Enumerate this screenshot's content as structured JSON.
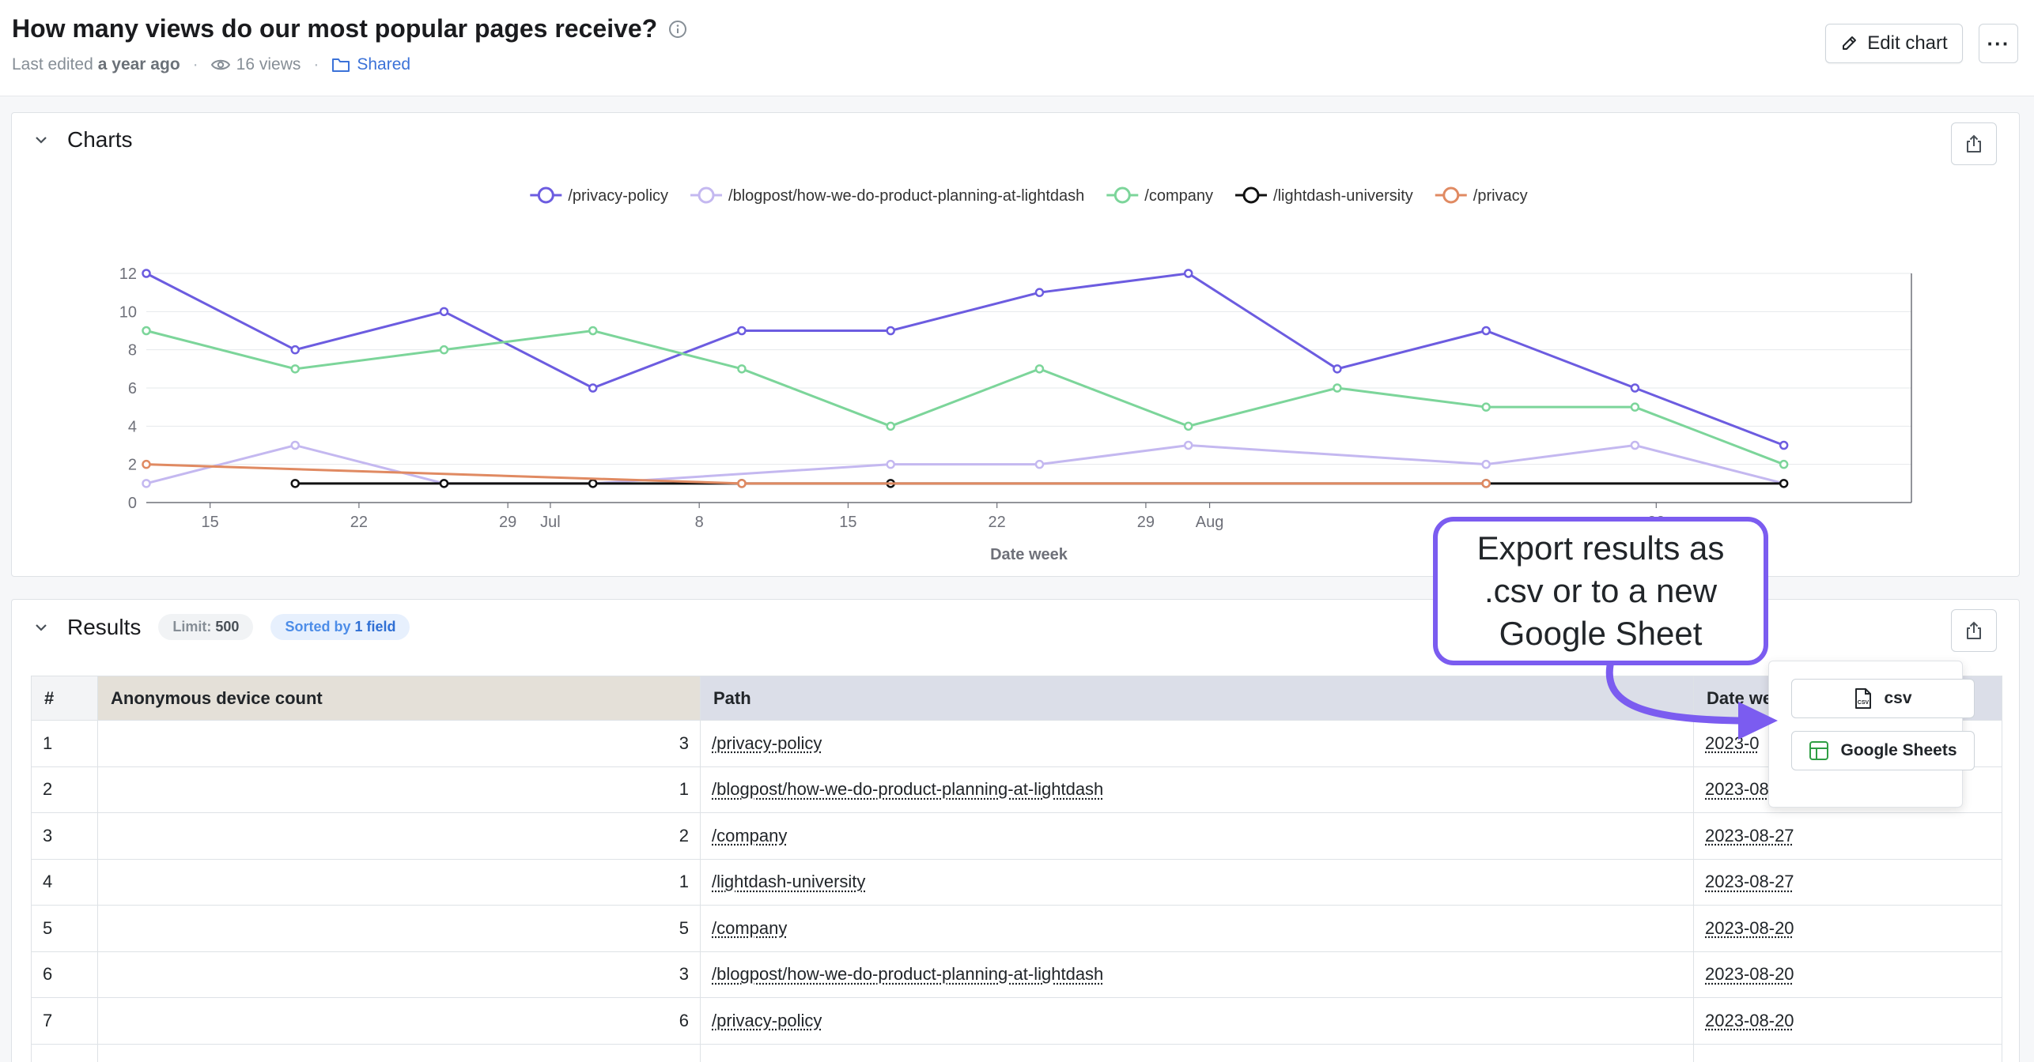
{
  "header": {
    "title": "How many views do our most popular pages receive?",
    "last_edited_prefix": "Last edited",
    "last_edited_value": "a year ago",
    "views": "16 views",
    "space": "Shared",
    "edit_label": "Edit chart",
    "more_label": "···"
  },
  "charts_panel": {
    "title": "Charts"
  },
  "chart_data": {
    "type": "line",
    "title": "",
    "xlabel": "Date week",
    "ylabel": "",
    "ylim": [
      0,
      12
    ],
    "yticks": [
      0,
      2,
      4,
      6,
      8,
      10,
      12
    ],
    "x_start": "2023-06-12",
    "x_end": "2023-09-03",
    "xticks": [
      {
        "date": "2023-06-15",
        "label": "15"
      },
      {
        "date": "2023-06-22",
        "label": "22"
      },
      {
        "date": "2023-06-29",
        "label": "29"
      },
      {
        "date": "2023-07-01",
        "label": "Jul"
      },
      {
        "date": "2023-07-08",
        "label": "8"
      },
      {
        "date": "2023-07-15",
        "label": "15"
      },
      {
        "date": "2023-07-22",
        "label": "22"
      },
      {
        "date": "2023-07-29",
        "label": "29"
      },
      {
        "date": "2023-08-01",
        "label": "Aug"
      },
      {
        "date": "2023-08-22",
        "label": "22"
      }
    ],
    "legend_position": "top-center",
    "grid": true,
    "series": [
      {
        "name": "/privacy-policy",
        "color": "#6c5ce0",
        "points": [
          [
            "2023-06-12",
            12
          ],
          [
            "2023-06-19",
            8
          ],
          [
            "2023-06-26",
            10
          ],
          [
            "2023-07-03",
            6
          ],
          [
            "2023-07-10",
            9
          ],
          [
            "2023-07-17",
            9
          ],
          [
            "2023-07-24",
            11
          ],
          [
            "2023-07-31",
            12
          ],
          [
            "2023-08-07",
            7
          ],
          [
            "2023-08-14",
            9
          ],
          [
            "2023-08-21",
            6
          ],
          [
            "2023-08-28",
            3
          ]
        ]
      },
      {
        "name": "/blogpost/how-we-do-product-planning-at-lightdash",
        "color": "#c4b8f0",
        "points": [
          [
            "2023-06-12",
            1
          ],
          [
            "2023-06-19",
            3
          ],
          [
            "2023-06-26",
            1
          ],
          [
            "2023-07-03",
            1
          ],
          [
            "2023-07-17",
            2
          ],
          [
            "2023-07-24",
            2
          ],
          [
            "2023-07-31",
            3
          ],
          [
            "2023-08-14",
            2
          ],
          [
            "2023-08-21",
            3
          ],
          [
            "2023-08-28",
            1
          ]
        ]
      },
      {
        "name": "/company",
        "color": "#7cd59a",
        "points": [
          [
            "2023-06-12",
            9
          ],
          [
            "2023-06-19",
            7
          ],
          [
            "2023-06-26",
            8
          ],
          [
            "2023-07-03",
            9
          ],
          [
            "2023-07-10",
            7
          ],
          [
            "2023-07-17",
            4
          ],
          [
            "2023-07-24",
            7
          ],
          [
            "2023-07-31",
            4
          ],
          [
            "2023-08-07",
            6
          ],
          [
            "2023-08-14",
            5
          ],
          [
            "2023-08-21",
            5
          ],
          [
            "2023-08-28",
            2
          ]
        ]
      },
      {
        "name": "/lightdash-university",
        "color": "#111111",
        "points": [
          [
            "2023-06-19",
            1
          ],
          [
            "2023-06-26",
            1
          ],
          [
            "2023-07-03",
            1
          ],
          [
            "2023-07-10",
            1
          ],
          [
            "2023-07-17",
            1
          ],
          [
            "2023-08-14",
            1
          ],
          [
            "2023-08-28",
            1
          ]
        ]
      },
      {
        "name": "/privacy",
        "color": "#e08a62",
        "points": [
          [
            "2023-06-12",
            2
          ],
          [
            "2023-07-10",
            1
          ],
          [
            "2023-08-14",
            1
          ]
        ]
      }
    ]
  },
  "results_panel": {
    "title": "Results",
    "limit_label": "Limit:",
    "limit_value": "500",
    "sorted_label": "Sorted by",
    "sorted_value": "1 field"
  },
  "table": {
    "columns": [
      "#",
      "Anonymous device count",
      "Path",
      "Date we"
    ],
    "rows": [
      [
        "1",
        "3",
        "/privacy-policy",
        "2023-0"
      ],
      [
        "2",
        "1",
        "/blogpost/how-we-do-product-planning-at-lightdash",
        "2023-08-27"
      ],
      [
        "3",
        "2",
        "/company",
        "2023-08-27"
      ],
      [
        "4",
        "1",
        "/lightdash-university",
        "2023-08-27"
      ],
      [
        "5",
        "5",
        "/company",
        "2023-08-20"
      ],
      [
        "6",
        "3",
        "/blogpost/how-we-do-product-planning-at-lightdash",
        "2023-08-20"
      ],
      [
        "7",
        "6",
        "/privacy-policy",
        "2023-08-20"
      ]
    ]
  },
  "export_menu": {
    "csv_label": "csv",
    "csv_icon_text": "CSV",
    "sheets_label": "Google Sheets"
  },
  "callout": {
    "text": "Export results as .csv or to a new Google Sheet",
    "border_color": "#7b5cf0"
  }
}
